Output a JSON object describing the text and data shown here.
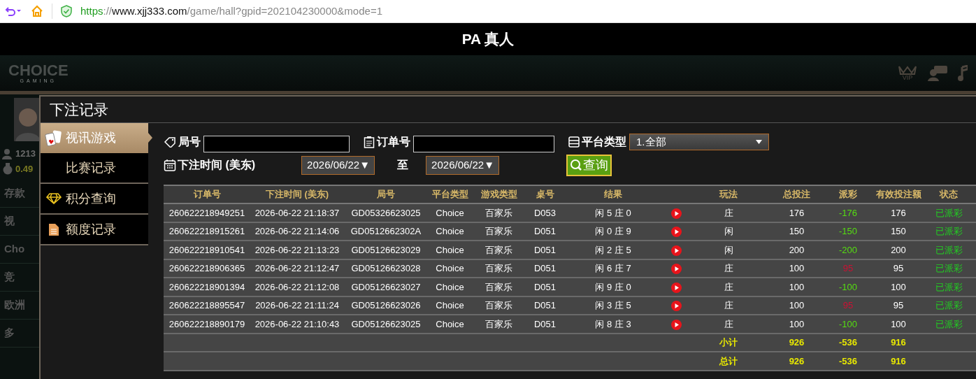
{
  "browser": {
    "url": {
      "scheme": "https",
      "separator": "://",
      "host": "www.xjj333.com",
      "path": "/game/hall?gpid=202104230000&mode=1"
    }
  },
  "header": {
    "title": "PA 真人"
  },
  "nav": {
    "logo": "CHOICE",
    "logo_sub": "GAMING",
    "vip_label": "VIP"
  },
  "background_sidebar": {
    "user_id": "1213",
    "balance": "0.49",
    "items": [
      "存款",
      "视",
      "Cho",
      "竞",
      "欧洲",
      "多"
    ]
  },
  "modal": {
    "title": "下注记录",
    "menu": [
      {
        "label": "视讯游戏",
        "kind": "cards",
        "selected": true
      },
      {
        "label": "比赛记录",
        "kind": "none",
        "selected": false
      },
      {
        "label": "积分查询",
        "kind": "diamond",
        "selected": false
      },
      {
        "label": "额度记录",
        "kind": "document",
        "selected": false
      }
    ],
    "filters": {
      "round_label": "局号",
      "order_label": "订单号",
      "platform_label": "平台类型",
      "platform_value": "1.全部",
      "time_label": "下注时间 (美东)",
      "date_from": "2026/06/22▼",
      "to_label": "至",
      "date_to": "2026/06/22▼",
      "query_button": "查询"
    },
    "table": {
      "columns": [
        "订单号",
        "下注时间 (美东)",
        "局号",
        "平台类型",
        "游戏类型",
        "桌号",
        "结果",
        "",
        "玩法",
        "总投注",
        "派彩",
        "有效投注额",
        "状态"
      ],
      "rows": [
        {
          "order": "260622218949251",
          "time": "2026-06-22 21:18:37",
          "round": "GD05326623025",
          "platform": "Choice",
          "game": "百家乐",
          "table": "D053",
          "result": "闲 5 庄 0",
          "bet_type": "庄",
          "total": "176",
          "payout": "-176",
          "color": "#55dd11",
          "valid": "176",
          "status": "已派彩"
        },
        {
          "order": "260622218915261",
          "time": "2026-06-22 21:14:06",
          "round": "GD0512662302A",
          "platform": "Choice",
          "game": "百家乐",
          "table": "D051",
          "result": "闲 0 庄 9",
          "bet_type": "闲",
          "total": "150",
          "payout": "-150",
          "color": "#55dd11",
          "valid": "150",
          "status": "已派彩"
        },
        {
          "order": "260622218910541",
          "time": "2026-06-22 21:13:23",
          "round": "GD05126623029",
          "platform": "Choice",
          "game": "百家乐",
          "table": "D051",
          "result": "闲 2 庄 5",
          "bet_type": "闲",
          "total": "200",
          "payout": "-200",
          "color": "#55dd11",
          "valid": "200",
          "status": "已派彩"
        },
        {
          "order": "260622218906365",
          "time": "2026-06-22 21:12:47",
          "round": "GD05126623028",
          "platform": "Choice",
          "game": "百家乐",
          "table": "D051",
          "result": "闲 6 庄 7",
          "bet_type": "庄",
          "total": "100",
          "payout": "95",
          "color": "#cc1133",
          "valid": "95",
          "status": "已派彩"
        },
        {
          "order": "260622218901394",
          "time": "2026-06-22 21:12:08",
          "round": "GD05126623027",
          "platform": "Choice",
          "game": "百家乐",
          "table": "D051",
          "result": "闲 9 庄 0",
          "bet_type": "庄",
          "total": "100",
          "payout": "-100",
          "color": "#55dd11",
          "valid": "100",
          "status": "已派彩"
        },
        {
          "order": "260622218895547",
          "time": "2026-06-22 21:11:24",
          "round": "GD05126623026",
          "platform": "Choice",
          "game": "百家乐",
          "table": "D051",
          "result": "闲 3 庄 5",
          "bet_type": "庄",
          "total": "100",
          "payout": "95",
          "color": "#cc1133",
          "valid": "95",
          "status": "已派彩"
        },
        {
          "order": "260622218890179",
          "time": "2026-06-22 21:10:43",
          "round": "GD05126623025",
          "platform": "Choice",
          "game": "百家乐",
          "table": "D051",
          "result": "闲 8 庄 3",
          "bet_type": "庄",
          "total": "100",
          "payout": "-100",
          "color": "#55dd11",
          "valid": "100",
          "status": "已派彩"
        }
      ],
      "totals": [
        {
          "label": "小计",
          "total": "926",
          "payout": "-536",
          "valid": "916"
        },
        {
          "label": "总计",
          "total": "926",
          "payout": "-536",
          "valid": "916"
        }
      ]
    }
  }
}
